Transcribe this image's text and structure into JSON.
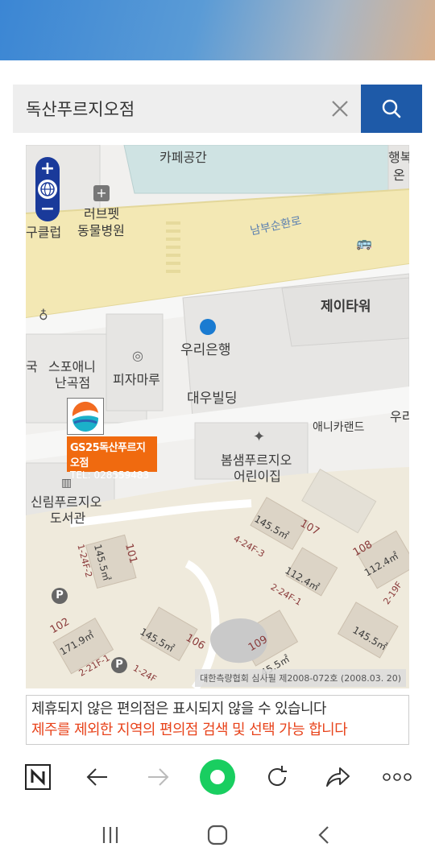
{
  "search": {
    "value": "독산푸르지오점"
  },
  "map": {
    "labels": {
      "cafe": "카페공간",
      "haengbok_1": "행복",
      "haengbok_2": "온",
      "club": "구클럽",
      "lovepet_1": "러브펫",
      "lovepet_2": "동물병원",
      "road": "남부순환로",
      "jtower": "제이타워",
      "bank": "우리은행",
      "sports_1": "스포애니",
      "sports_2": "난곡점",
      "guk": "국",
      "pizza": "피자마루",
      "daewoo": "대우빌딩",
      "anycare": "애니카랜드",
      "woori_right": "우리",
      "bomsaem_1": "봄샘푸르지오",
      "bomsaem_2": "어린이집",
      "library_1": "신림푸르지오",
      "library_2": "도서관",
      "b107": "107",
      "b108": "108",
      "b101": "101",
      "b102": "102",
      "b106": "106",
      "b109": "109",
      "a1": "145.5㎡",
      "a2": "145.5㎡",
      "a3": "112.4㎡",
      "a4": "112.4㎡",
      "a5": "171.9㎡",
      "a6": "145.5㎡",
      "a7": "145.5㎡",
      "a8": "45.5㎡",
      "c1": "4-24F-3",
      "c2": "2-24F-1",
      "c3": "1-24F-2",
      "c4": "2-19F",
      "c5": "2-21F-1",
      "c6": "1-24F"
    },
    "poi": {
      "name": "GS25독산푸르지오점",
      "tel": "TEL: 028559483"
    },
    "copyright": "대한측량협회 심사필 제2008-072호 (2008.03. 20)",
    "zoom_in": "+",
    "zoom_out": "−"
  },
  "notice": {
    "line1": "제휴되지 않은 편의점은 표시되지 않을 수 있습니다",
    "line2": "제주를 제외한 지역의 편의점 검색 및 선택 가능 합니다"
  },
  "colors": {
    "accent": "#1e5aa8",
    "poi": "#f06a0f",
    "notice_red": "#e8431b",
    "road": "#f3e8b4"
  }
}
